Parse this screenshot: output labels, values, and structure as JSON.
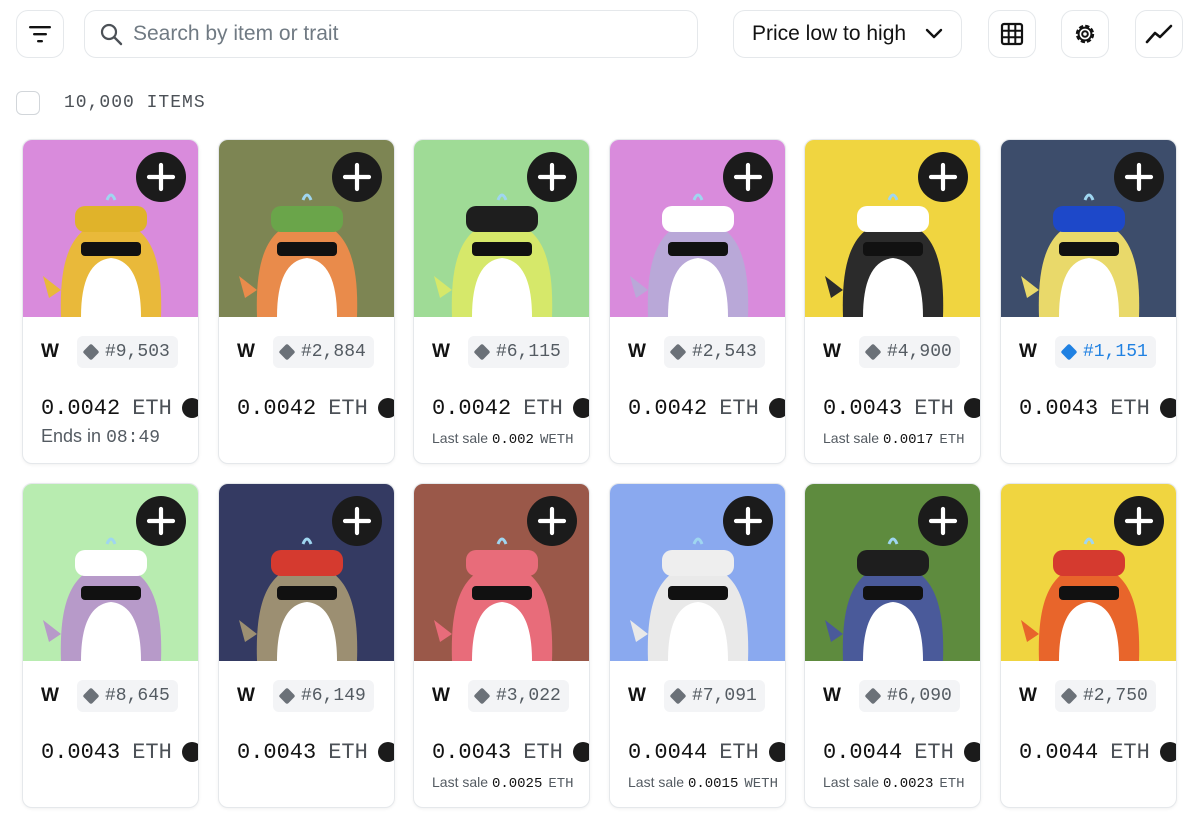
{
  "toolbar": {
    "filter_icon": "filter-lines-icon",
    "search_placeholder": "Search by item or trait",
    "sort_label": "Price low to high",
    "grid_icon": "grid-icon",
    "settings_icon": "gear-icon",
    "activity_icon": "trend-line-icon"
  },
  "items_count": "10,000 ITEMS",
  "colors": {
    "accent_blue": "#2081e2",
    "dark": "#1b1b1b"
  },
  "cards": [
    {
      "bg": "#d98bdc",
      "collection": "W",
      "token": "#9,503",
      "price": "0.0042",
      "unit": "ETH",
      "sub_type": "ends",
      "sub_prefix": "Ends in",
      "sub_value": "08:49",
      "sub_unit": "",
      "highlight": false,
      "hat": "#e0b32a",
      "body": "#e9b93a"
    },
    {
      "bg": "#7d8553",
      "collection": "W",
      "token": "#2,884",
      "price": "0.0042",
      "unit": "ETH",
      "sub_type": "none",
      "sub_prefix": "",
      "sub_value": "",
      "sub_unit": "",
      "highlight": false,
      "hat": "#6aa54a",
      "body": "#e98b4b"
    },
    {
      "bg": "#9fdb96",
      "collection": "W",
      "token": "#6,115",
      "price": "0.0042",
      "unit": "ETH",
      "sub_type": "last",
      "sub_prefix": "Last sale",
      "sub_value": "0.002",
      "sub_unit": "WETH",
      "highlight": false,
      "hat": "#1e1e1e",
      "body": "#d6e86a"
    },
    {
      "bg": "#d98bdc",
      "collection": "W",
      "token": "#2,543",
      "price": "0.0042",
      "unit": "ETH",
      "sub_type": "none",
      "sub_prefix": "",
      "sub_value": "",
      "sub_unit": "",
      "highlight": false,
      "hat": "#ffffff",
      "body": "#b9a8d8"
    },
    {
      "bg": "#f0d540",
      "collection": "W",
      "token": "#4,900",
      "price": "0.0043",
      "unit": "ETH",
      "sub_type": "last",
      "sub_prefix": "Last sale",
      "sub_value": "0.0017",
      "sub_unit": "ETH",
      "highlight": false,
      "hat": "#ffffff",
      "body": "#2b2b2b"
    },
    {
      "bg": "#3d4d6b",
      "collection": "W",
      "token": "#1,151",
      "price": "0.0043",
      "unit": "ETH",
      "sub_type": "none",
      "sub_prefix": "",
      "sub_value": "",
      "sub_unit": "",
      "highlight": true,
      "hat": "#1d48c9",
      "body": "#e9d96a"
    },
    {
      "bg": "#b8ecb0",
      "collection": "W",
      "token": "#8,645",
      "price": "0.0043",
      "unit": "ETH",
      "sub_type": "none",
      "sub_prefix": "",
      "sub_value": "",
      "sub_unit": "",
      "highlight": false,
      "hat": "#ffffff",
      "body": "#b79ac9"
    },
    {
      "bg": "#343a62",
      "collection": "W",
      "token": "#6,149",
      "price": "0.0043",
      "unit": "ETH",
      "sub_type": "none",
      "sub_prefix": "",
      "sub_value": "",
      "sub_unit": "",
      "highlight": false,
      "hat": "#d53a2f",
      "body": "#9c8f72"
    },
    {
      "bg": "#9a5849",
      "collection": "W",
      "token": "#3,022",
      "price": "0.0043",
      "unit": "ETH",
      "sub_type": "last",
      "sub_prefix": "Last sale",
      "sub_value": "0.0025",
      "sub_unit": "ETH",
      "highlight": false,
      "hat": "#e86c7a",
      "body": "#e86c7a"
    },
    {
      "bg": "#8aa9ef",
      "collection": "W",
      "token": "#7,091",
      "price": "0.0044",
      "unit": "ETH",
      "sub_type": "last",
      "sub_prefix": "Last sale",
      "sub_value": "0.0015",
      "sub_unit": "WETH",
      "highlight": false,
      "hat": "#eeeeee",
      "body": "#e9e9e9"
    },
    {
      "bg": "#5e8b3e",
      "collection": "W",
      "token": "#6,090",
      "price": "0.0044",
      "unit": "ETH",
      "sub_type": "last",
      "sub_prefix": "Last sale",
      "sub_value": "0.0023",
      "sub_unit": "ETH",
      "highlight": false,
      "hat": "#1e1e1e",
      "body": "#4a5a9a"
    },
    {
      "bg": "#f0d540",
      "collection": "W",
      "token": "#2,750",
      "price": "0.0044",
      "unit": "ETH",
      "sub_type": "none",
      "sub_prefix": "",
      "sub_value": "",
      "sub_unit": "",
      "highlight": false,
      "hat": "#d53a2f",
      "body": "#e8652b"
    }
  ]
}
